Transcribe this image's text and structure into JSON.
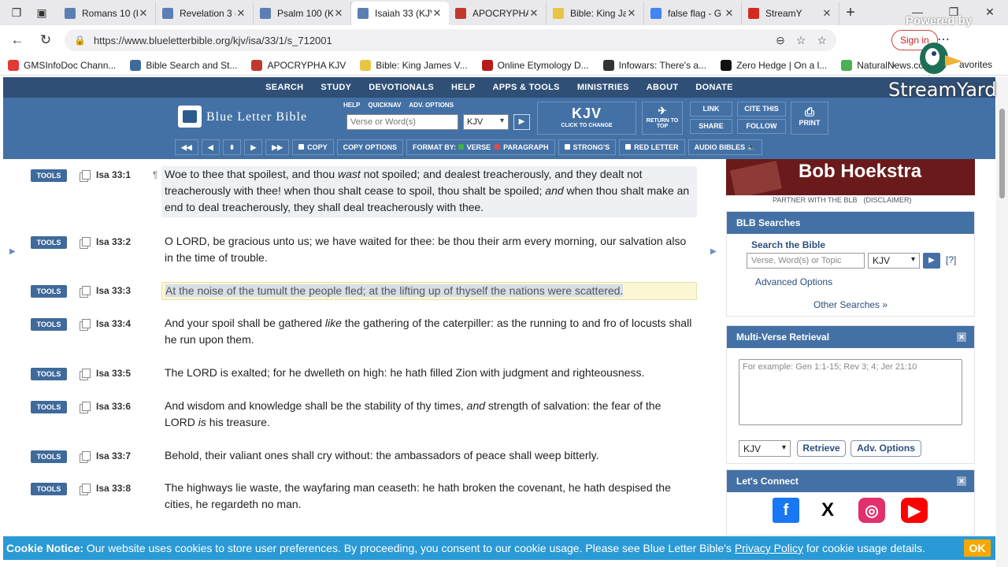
{
  "browser": {
    "tabs": [
      {
        "title": "Romans 10 (K",
        "color": "#5b7fb5"
      },
      {
        "title": "Revelation 3 (",
        "color": "#5b7fb5"
      },
      {
        "title": "Psalm 100 (K",
        "color": "#5b7fb5"
      },
      {
        "title": "Isaiah 33 (KJV",
        "color": "#5b7fb5"
      },
      {
        "title": "APOCRYPHA",
        "color": "#c0392b"
      },
      {
        "title": "Bible: King Ja",
        "color": "#e8c542"
      },
      {
        "title": "false flag - G",
        "color": "#4285f4"
      },
      {
        "title": "StreamY",
        "color": "#d52b1e"
      }
    ],
    "new_tab": "+",
    "url": "https://www.blueletterbible.org/kjv/isa/33/1/s_712001",
    "sign_in": "Sign in",
    "bookmarks": [
      {
        "label": "GMSInfoDoc Chann...",
        "color": "#e53935"
      },
      {
        "label": "Bible Search and St...",
        "color": "#3f6a9b"
      },
      {
        "label": "APOCRYPHA KJV",
        "color": "#c0392b"
      },
      {
        "label": "Bible: King James V...",
        "color": "#e8c542"
      },
      {
        "label": "Online Etymology D...",
        "color": "#b71c1c"
      },
      {
        "label": "Infowars: There's a...",
        "color": "#333333"
      },
      {
        "label": "Zero Hedge | On a l...",
        "color": "#111111"
      },
      {
        "label": "NaturalNews.com",
        "color": "#4caf50"
      }
    ],
    "favorites": "avorites"
  },
  "overlay": {
    "powered": "Powered by",
    "brand": "StreamYard"
  },
  "blb": {
    "top_nav": [
      "SEARCH",
      "STUDY",
      "DEVOTIONALS",
      "HELP",
      "APPS & TOOLS",
      "MINISTRIES",
      "ABOUT",
      "DONATE"
    ],
    "logo": "Blue Letter Bible",
    "mini_links": [
      "HELP",
      "QUICKNAV",
      "ADV. OPTIONS"
    ],
    "search_placeholder": "Verse or Word(s)",
    "version": "KJV",
    "kjv_big": "KJV",
    "kjv_small": "CLICK TO CHANGE",
    "return_top": "RETURN TO TOP",
    "link": "LINK",
    "share": "SHARE",
    "cite": "CITE THIS",
    "follow": "FOLLOW",
    "print": "PRINT",
    "copy": "COPY",
    "copy_options": "COPY OPTIONS",
    "format_by": "FORMAT BY:",
    "verse": "VERSE",
    "paragraph": "PARAGRAPH",
    "strongs": "STRONG'S",
    "red_letter": "RED LETTER",
    "audio": "AUDIO BIBLES"
  },
  "verses": [
    {
      "ref": "Isa 33:1",
      "tools": "TOOLS",
      "parts": [
        "Woe to thee that spoilest, and thou ",
        "wast",
        " not spoiled; and dealest treacherously, and they dealt not treacherously with thee! when thou shalt cease to spoil, thou shalt be spoiled; ",
        "and",
        " when thou shalt make an end to deal treacherously, they shall deal treacherously with thee."
      ]
    },
    {
      "ref": "Isa 33:2",
      "tools": "TOOLS",
      "text": "O LORD, be gracious unto us; we have waited for thee: be thou their arm every morning, our salvation also in the time of trouble."
    },
    {
      "ref": "Isa 33:3",
      "tools": "TOOLS",
      "text": "At the noise of the tumult the people fled; at the lifting up of thyself the nations were scattered."
    },
    {
      "ref": "Isa 33:4",
      "tools": "TOOLS",
      "parts": [
        "And your spoil shall be gathered ",
        "like",
        " the gathering of the caterpiller: as the running to and fro of locusts shall he run upon them."
      ]
    },
    {
      "ref": "Isa 33:5",
      "tools": "TOOLS",
      "text": "The LORD is exalted; for he dwelleth on high: he hath filled Zion with judgment and righteousness."
    },
    {
      "ref": "Isa 33:6",
      "tools": "TOOLS",
      "parts": [
        "And wisdom and knowledge shall be the stability of thy times, ",
        "and",
        " strength of salvation: the fear of the LORD ",
        "is",
        " his treasure."
      ]
    },
    {
      "ref": "Isa 33:7",
      "tools": "TOOLS",
      "text": "Behold, their valiant ones shall cry without: the ambassadors of peace shall weep bitterly."
    },
    {
      "ref": "Isa 33:8",
      "tools": "TOOLS",
      "text": "The highways lie waste, the wayfaring man ceaseth: he hath broken the covenant, he hath despised the cities, he regardeth no man."
    }
  ],
  "right": {
    "banner_name": "Bob Hoekstra",
    "partner": "PARTNER WITH THE BLB",
    "disclaimer": "(DISCLAIMER)",
    "searches_title": "BLB Searches",
    "search_label": "Search the Bible",
    "search_placeholder": "Verse, Word(s) or Topic",
    "search_version": "KJV",
    "help": "[?]",
    "advanced": "Advanced Options",
    "other": "Other Searches",
    "mvr_title": "Multi-Verse Retrieval",
    "mvr_placeholder": "For example: Gen 1:1-15; Rev 3; 4; Jer 21:10",
    "mvr_version": "KJV",
    "retrieve": "Retrieve",
    "adv_options": "Adv. Options",
    "connect_title": "Let's Connect",
    "social": [
      {
        "name": "facebook-icon",
        "glyph": "f",
        "bg": "#1877f2",
        "fg": "#ffffff"
      },
      {
        "name": "x-icon",
        "glyph": "X",
        "bg": "#ffffff",
        "fg": "#000000"
      },
      {
        "name": "instagram-icon",
        "glyph": "◎",
        "bg": "#e1306c",
        "fg": "#ffffff"
      },
      {
        "name": "youtube-icon",
        "glyph": "▶",
        "bg": "#ff0000",
        "fg": "#ffffff"
      }
    ]
  },
  "cookie": {
    "label": "Cookie Notice:",
    "text": " Our website uses cookies to store user preferences. By proceeding, you consent to our cookie usage. Please see Blue Letter Bible's ",
    "link": "Privacy Policy",
    "tail": " for cookie usage details.",
    "ok": "OK"
  }
}
